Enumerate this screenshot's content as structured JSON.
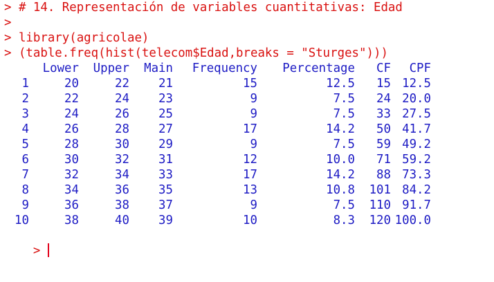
{
  "console": {
    "prompt": ">",
    "lines": [
      "> # 14. Representación de variables cuantitativas: Edad",
      ">",
      "> library(agricolae)",
      "> (table.freq(hist(telecom$Edad,breaks = \"Sturges\")))"
    ],
    "colors": {
      "input": "#d9100f",
      "output": "#1d1bc4",
      "caret": "#e2001a"
    }
  },
  "table": {
    "headers": [
      "Lower",
      "Upper",
      "Main",
      "Frequency",
      "Percentage",
      "CF",
      "CPF"
    ],
    "rows": [
      {
        "id": "1",
        "cells": [
          "20",
          "22",
          "21",
          "15",
          "12.5",
          "15",
          "12.5"
        ]
      },
      {
        "id": "2",
        "cells": [
          "22",
          "24",
          "23",
          "9",
          "7.5",
          "24",
          "20.0"
        ]
      },
      {
        "id": "3",
        "cells": [
          "24",
          "26",
          "25",
          "9",
          "7.5",
          "33",
          "27.5"
        ]
      },
      {
        "id": "4",
        "cells": [
          "26",
          "28",
          "27",
          "17",
          "14.2",
          "50",
          "41.7"
        ]
      },
      {
        "id": "5",
        "cells": [
          "28",
          "30",
          "29",
          "9",
          "7.5",
          "59",
          "49.2"
        ]
      },
      {
        "id": "6",
        "cells": [
          "30",
          "32",
          "31",
          "12",
          "10.0",
          "71",
          "59.2"
        ]
      },
      {
        "id": "7",
        "cells": [
          "32",
          "34",
          "33",
          "17",
          "14.2",
          "88",
          "73.3"
        ]
      },
      {
        "id": "8",
        "cells": [
          "34",
          "36",
          "35",
          "13",
          "10.8",
          "101",
          "84.2"
        ]
      },
      {
        "id": "9",
        "cells": [
          "36",
          "38",
          "37",
          "9",
          "7.5",
          "110",
          "91.7"
        ]
      },
      {
        "id": "10",
        "cells": [
          "38",
          "40",
          "39",
          "10",
          "8.3",
          "120",
          "100.0"
        ]
      }
    ]
  }
}
